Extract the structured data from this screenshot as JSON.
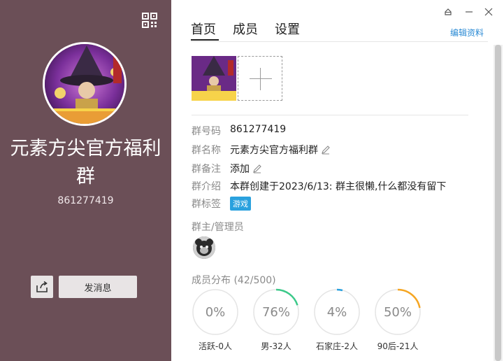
{
  "left_panel": {
    "group_name": "元素方尖官方福利群",
    "group_number": "861277419",
    "send_message_label": "发消息",
    "colors": {
      "background": "#6b4f57"
    }
  },
  "tabs": [
    {
      "label": "首页",
      "active": true
    },
    {
      "label": "成员",
      "active": false
    },
    {
      "label": "设置",
      "active": false
    }
  ],
  "edit_profile_label": "编辑资料",
  "info": {
    "group_id": {
      "label": "群号码",
      "value": "861277419"
    },
    "group_name": {
      "label": "群名称",
      "value": "元素方尖官方福利群"
    },
    "group_remark": {
      "label": "群备注",
      "value": "添加"
    },
    "group_intro": {
      "label": "群介绍",
      "value": "本群创建于2023/6/13:  群主很懒,什么都没有留下"
    },
    "group_tags": {
      "label": "群标签",
      "tag": "游戏"
    }
  },
  "admins_header": "群主/管理员",
  "member_distribution": {
    "header": "成员分布",
    "count": "(42/500)",
    "stats": [
      {
        "percent": "0%",
        "label": "活跃-0人",
        "fraction": 0,
        "color": "#2aa1de"
      },
      {
        "percent": "76%",
        "label": "男-32人",
        "fraction": 0.2,
        "color": "#3dc98a"
      },
      {
        "percent": "4%",
        "label": "石家庄-2人",
        "fraction": 0.04,
        "color": "#2aa1de"
      },
      {
        "percent": "50%",
        "label": "90后-21人",
        "fraction": 0.22,
        "color": "#f5a623"
      }
    ]
  },
  "icons": [
    "qr-code-icon",
    "share-icon",
    "pin-icon",
    "minimize-icon",
    "close-icon",
    "pencil-icon"
  ]
}
